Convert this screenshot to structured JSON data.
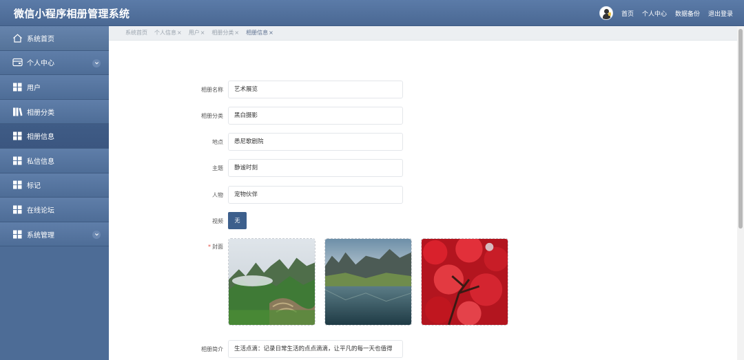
{
  "header": {
    "title": "微信小程序相册管理系统",
    "links": [
      "首页",
      "个人中心",
      "数据备份",
      "退出登录"
    ]
  },
  "sidebar": {
    "items": [
      {
        "label": "系统首页",
        "icon": "home-icon"
      },
      {
        "label": "个人中心",
        "icon": "wallet-icon",
        "expandable": true
      },
      {
        "label": "用户",
        "icon": "grid-icon"
      },
      {
        "label": "相册分类",
        "icon": "book-icon"
      },
      {
        "label": "相册信息",
        "icon": "grid-icon",
        "active": true
      },
      {
        "label": "私信信息",
        "icon": "grid-icon"
      },
      {
        "label": "标记",
        "icon": "grid-icon"
      },
      {
        "label": "在线论坛",
        "icon": "grid-icon"
      },
      {
        "label": "系统管理",
        "icon": "grid-icon",
        "expandable": true
      }
    ]
  },
  "breadcrumb": {
    "tabs": [
      {
        "label": "系统首页",
        "closable": false
      },
      {
        "label": "个人信息",
        "closable": true
      },
      {
        "label": "用户",
        "closable": true
      },
      {
        "label": "相册分类",
        "closable": true
      },
      {
        "label": "相册信息",
        "closable": true,
        "active": true
      }
    ],
    "close_glyph": "×"
  },
  "form": {
    "album_name_label": "相册名称",
    "album_name_value": "艺术展览",
    "category_label": "相册分类",
    "category_value": "黑白摄影",
    "location_label": "地点",
    "location_value": "悉尼歌剧院",
    "theme_label": "主题",
    "theme_value": "静谧时刻",
    "person_label": "人物",
    "person_value": "宠物伙伴",
    "video_label": "视频",
    "video_button": "无",
    "cover_label": "封面",
    "cover_required_mark": "*",
    "intro_label": "相册简介",
    "intro_value": "生活点滴：记录日常生活的点点滴滴，让平凡的每一天也值得"
  },
  "colors": {
    "header": "#4a6893",
    "sidebar": "#4d6c96",
    "active_item": "#3d5a84",
    "button": "#3d5f8c"
  }
}
